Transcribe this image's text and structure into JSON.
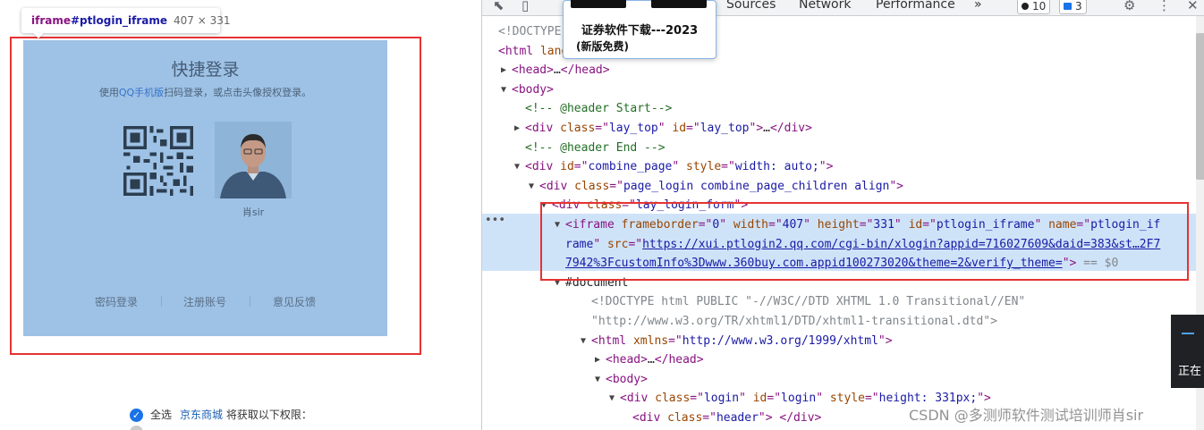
{
  "tooltip": {
    "tag": "iframe",
    "id": "#ptlogin_iframe",
    "size": "407 × 331"
  },
  "login": {
    "title": "快捷登录",
    "sub_prefix": "使用",
    "sub_link": "QQ手机版",
    "sub_suffix": "扫码登录，或点击头像授权登录。",
    "avatar_name": "肖sir",
    "footer_links": [
      "密码登录",
      "注册账号",
      "意见反馈"
    ]
  },
  "permission": {
    "check_all": "全选",
    "brand": "京东商城",
    "text": "将获取以下权限："
  },
  "devtools": {
    "tabs": [
      "Sources",
      "Network",
      "Performance"
    ],
    "more": "»",
    "error_count": "10",
    "message_count": "3",
    "ad": {
      "line1": "证券软件下载---2023",
      "line2": "(新版免费)"
    },
    "side_text": "正在",
    "dom_lines": [
      {
        "i": 0,
        "tri": "",
        "parts": [
          [
            "gr",
            "<!DOCTYPE"
          ]
        ]
      },
      {
        "i": 0,
        "tri": "",
        "parts": [
          [
            "tg",
            "<html"
          ],
          [
            "blk",
            " "
          ],
          [
            "at",
            "lang"
          ]
        ]
      },
      {
        "i": 1,
        "tri": "▶",
        "parts": [
          [
            "tg",
            "<head>"
          ],
          [
            "blk",
            "…"
          ],
          [
            "tg",
            "</head>"
          ]
        ]
      },
      {
        "i": 1,
        "tri": "▼",
        "parts": [
          [
            "tg",
            "<body>"
          ]
        ]
      },
      {
        "i": 2,
        "tri": "",
        "parts": [
          [
            "cm",
            "<!-- @header Start-->"
          ]
        ]
      },
      {
        "i": 2,
        "tri": "▶",
        "parts": [
          [
            "tg",
            "<div "
          ],
          [
            "at",
            "class"
          ],
          [
            "tg",
            "=\""
          ],
          [
            "av",
            "lay_top"
          ],
          [
            "tg",
            "\" "
          ],
          [
            "at",
            "id"
          ],
          [
            "tg",
            "=\""
          ],
          [
            "av",
            "lay_top"
          ],
          [
            "tg",
            "\">"
          ],
          [
            "blk",
            "…"
          ],
          [
            "tg",
            "</div>"
          ]
        ]
      },
      {
        "i": 2,
        "tri": "",
        "parts": [
          [
            "cm",
            "<!-- @header End -->"
          ]
        ]
      },
      {
        "i": 2,
        "tri": "▼",
        "parts": [
          [
            "tg",
            "<div "
          ],
          [
            "at",
            "id"
          ],
          [
            "tg",
            "=\""
          ],
          [
            "av",
            "combine_page"
          ],
          [
            "tg",
            "\" "
          ],
          [
            "at",
            "style"
          ],
          [
            "tg",
            "=\""
          ],
          [
            "av",
            "width: auto;"
          ],
          [
            "tg",
            "\">"
          ]
        ]
      },
      {
        "i": 3,
        "tri": "▼",
        "parts": [
          [
            "tg",
            "<div "
          ],
          [
            "at",
            "class"
          ],
          [
            "tg",
            "=\""
          ],
          [
            "av",
            "page_login combine_page_children align"
          ],
          [
            "tg",
            "\">"
          ]
        ]
      },
      {
        "i": 4,
        "tri": "▼",
        "parts": [
          [
            "tg",
            "<div "
          ],
          [
            "at",
            "class"
          ],
          [
            "tg",
            "=\""
          ],
          [
            "av",
            "lay_login_form"
          ],
          [
            "tg",
            "\">"
          ]
        ]
      },
      {
        "i": 5,
        "tri": "▼",
        "parts": [
          [
            "tg",
            "<iframe "
          ],
          [
            "at",
            "frameborder"
          ],
          [
            "tg",
            "=\""
          ],
          [
            "av",
            "0"
          ],
          [
            "tg",
            "\" "
          ],
          [
            "at",
            "width"
          ],
          [
            "tg",
            "=\""
          ],
          [
            "av",
            "407"
          ],
          [
            "tg",
            "\" "
          ],
          [
            "at",
            "height"
          ],
          [
            "tg",
            "=\""
          ],
          [
            "av",
            "331"
          ],
          [
            "tg",
            "\" "
          ],
          [
            "at",
            "id"
          ],
          [
            "tg",
            "=\""
          ],
          [
            "av",
            "ptlogin_iframe"
          ],
          [
            "tg",
            "\" "
          ],
          [
            "at",
            "name"
          ],
          [
            "tg",
            "=\""
          ],
          [
            "av",
            "ptlogin_if"
          ]
        ]
      },
      {
        "i": 6,
        "tri": "",
        "parts": [
          [
            "av",
            "rame"
          ],
          [
            "tg",
            "\" "
          ],
          [
            "at",
            "src"
          ],
          [
            "tg",
            "=\""
          ],
          [
            "lk",
            "https://xui.ptlogin2.qq.com/cgi-bin/xlogin?appid=716027609&daid=383&st…2F7"
          ]
        ]
      },
      {
        "i": 6,
        "tri": "",
        "parts": [
          [
            "lk",
            "7942%3FcustomInfo%3Dwww.360buy.com.appid100273020&theme=2&verify_theme="
          ],
          [
            "tg",
            "\">"
          ],
          [
            "gr",
            " == $0"
          ]
        ]
      },
      {
        "i": 6,
        "tri": "▼",
        "parts": [
          [
            "blk",
            "#document"
          ]
        ]
      },
      {
        "i": 7,
        "tri": "",
        "parts": [
          [
            "gr",
            "<!DOCTYPE html PUBLIC \"-//W3C//DTD XHTML 1.0 Transitional//EN\""
          ]
        ]
      },
      {
        "i": 7,
        "tri": "",
        "parts": [
          [
            "gr",
            "\"http://www.w3.org/TR/xhtml1/DTD/xhtml1-transitional.dtd\">"
          ]
        ]
      },
      {
        "i": 7,
        "tri": "▼",
        "parts": [
          [
            "tg",
            "<html "
          ],
          [
            "at",
            "xmlns"
          ],
          [
            "tg",
            "=\""
          ],
          [
            "av",
            "http://www.w3.org/1999/xhtml"
          ],
          [
            "tg",
            "\">"
          ]
        ]
      },
      {
        "i": 8,
        "tri": "▶",
        "parts": [
          [
            "tg",
            "<head>"
          ],
          [
            "blk",
            "…"
          ],
          [
            "tg",
            "</head>"
          ]
        ]
      },
      {
        "i": 8,
        "tri": "▼",
        "parts": [
          [
            "tg",
            "<body>"
          ]
        ]
      },
      {
        "i": 9,
        "tri": "▼",
        "parts": [
          [
            "tg",
            "<div "
          ],
          [
            "at",
            "class"
          ],
          [
            "tg",
            "=\""
          ],
          [
            "av",
            "login"
          ],
          [
            "tg",
            "\" "
          ],
          [
            "at",
            "id"
          ],
          [
            "tg",
            "=\""
          ],
          [
            "av",
            "login"
          ],
          [
            "tg",
            "\" "
          ],
          [
            "at",
            "style"
          ],
          [
            "tg",
            "=\""
          ],
          [
            "av",
            "height: 331px;"
          ],
          [
            "tg",
            "\">"
          ]
        ]
      },
      {
        "i": 10,
        "tri": "",
        "parts": [
          [
            "tg",
            "<div "
          ],
          [
            "at",
            "class"
          ],
          [
            "tg",
            "=\""
          ],
          [
            "av",
            "header"
          ],
          [
            "tg",
            "\"> </div>"
          ]
        ]
      }
    ]
  },
  "watermark": "CSDN @多测师软件测试培训师肖sir",
  "colors": {
    "highlight": "#cfe3f8",
    "red_box": "#e53333",
    "iframe_overlay": "#9ec2e6"
  }
}
